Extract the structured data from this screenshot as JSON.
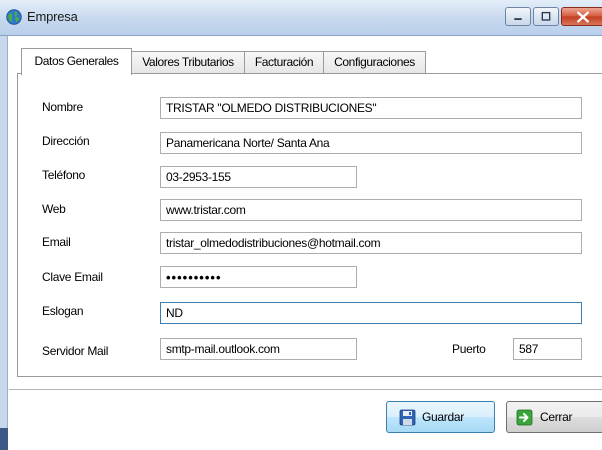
{
  "window": {
    "title": "Empresa"
  },
  "tabs": [
    {
      "label": "Datos Generales",
      "active": true
    },
    {
      "label": "Valores Tributarios",
      "active": false
    },
    {
      "label": "Facturación",
      "active": false
    },
    {
      "label": "Configuraciones",
      "active": false
    }
  ],
  "form": {
    "nombre": {
      "label": "Nombre",
      "value": "TRISTAR \"OLMEDO DISTRIBUCIONES\""
    },
    "direccion": {
      "label": "Dirección",
      "value": "Panamericana Norte/ Santa Ana"
    },
    "telefono": {
      "label": "Teléfono",
      "value": "03-2953-155"
    },
    "web": {
      "label": "Web",
      "value": "www.tristar.com"
    },
    "email": {
      "label": "Email",
      "value": "tristar_olmedodistribuciones@hotmail.com"
    },
    "clave_email": {
      "label": "Clave Email",
      "value": "••••••••••"
    },
    "eslogan": {
      "label": "Eslogan",
      "value": "ND"
    },
    "servidor_mail": {
      "label": "Servidor Mail",
      "value": "smtp-mail.outlook.com"
    },
    "puerto": {
      "label": "Puerto",
      "value": "587"
    }
  },
  "buttons": {
    "save_label": "Guardar",
    "close_label": "Cerrar"
  },
  "icons": {
    "app": "globe-icon",
    "save": "floppy-disk-icon",
    "close": "exit-arrow-icon"
  },
  "colors": {
    "titlebar": "#c6d8ee",
    "close_button": "#c23d20",
    "focus_border": "#3c7fb1"
  }
}
